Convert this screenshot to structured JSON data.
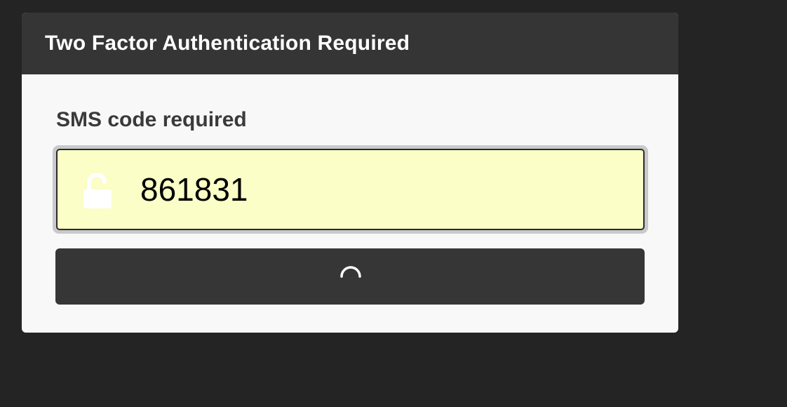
{
  "dialog": {
    "title": "Two Factor Authentication Required",
    "field_label": "SMS code required",
    "code_value": "861831",
    "submit_state": "loading"
  },
  "icons": {
    "field_icon": "unlock-icon",
    "button_icon": "loading-spinner-icon"
  },
  "colors": {
    "page_background": "#242424",
    "header_background": "#353535",
    "dialog_background": "#f8f8f8",
    "input_background": "#fbfec6",
    "button_background": "#363636"
  }
}
